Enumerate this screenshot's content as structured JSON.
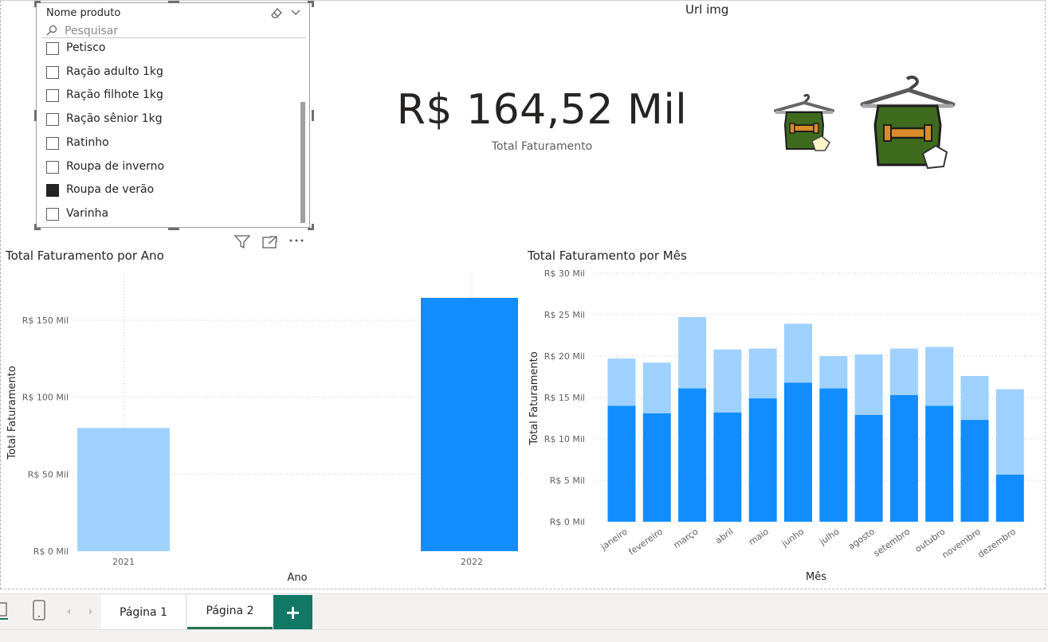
{
  "slicer": {
    "title": "Nome produto",
    "search_placeholder": "Pesquisar",
    "items": [
      {
        "label": "Petisco",
        "checked": false
      },
      {
        "label": "Ração adulto 1kg",
        "checked": false
      },
      {
        "label": "Ração filhote 1kg",
        "checked": false
      },
      {
        "label": "Ração sênior 1kg",
        "checked": false
      },
      {
        "label": "Ratinho",
        "checked": false
      },
      {
        "label": "Roupa de inverno",
        "checked": false
      },
      {
        "label": "Roupa de verão",
        "checked": true
      },
      {
        "label": "Varinha",
        "checked": false
      }
    ]
  },
  "image_visual": {
    "title": "Url img"
  },
  "card": {
    "value": "R$ 164,52 Mil",
    "label": "Total Faturamento"
  },
  "chart_data": [
    {
      "type": "bar",
      "title": "Total Faturamento por Ano",
      "xlabel": "Ano",
      "ylabel": "Total Faturamento",
      "categories": [
        "2021",
        "2022"
      ],
      "values": [
        80,
        164.52
      ],
      "ylim": [
        0,
        160
      ],
      "yticks": [
        0,
        50,
        100,
        150
      ],
      "ytick_labels": [
        "R$ 0 Mil",
        "R$ 50 Mil",
        "R$ 100 Mil",
        "R$ 150 Mil"
      ],
      "colors": [
        "#9fd1ff",
        "#118dff"
      ],
      "grid": true
    },
    {
      "type": "bar",
      "stacked": true,
      "title": "Total Faturamento por Mês",
      "xlabel": "Mês",
      "ylabel": "Total Faturamento",
      "categories": [
        "janeiro",
        "fevereiro",
        "março",
        "abril",
        "maio",
        "junho",
        "julho",
        "agosto",
        "setembro",
        "outubro",
        "novembro",
        "dezembro"
      ],
      "series": [
        {
          "values": [
            14.0,
            13.1,
            16.1,
            13.2,
            14.9,
            16.8,
            16.1,
            12.9,
            15.3,
            14.0,
            12.3,
            5.7
          ],
          "color": "#118dff"
        },
        {
          "values": [
            5.7,
            6.1,
            8.6,
            7.6,
            6.0,
            7.1,
            3.9,
            7.3,
            5.6,
            7.1,
            5.3,
            10.3
          ],
          "color": "#9fd1ff"
        }
      ],
      "ylim": [
        0,
        30
      ],
      "yticks": [
        0,
        5,
        10,
        15,
        20,
        25,
        30
      ],
      "ytick_labels": [
        "R$ 0 Mil",
        "R$ 5 Mil",
        "R$ 10 Mil",
        "R$ 15 Mil",
        "R$ 20 Mil",
        "R$ 25 Mil",
        "R$ 30 Mil"
      ],
      "grid": true
    }
  ],
  "tabs": [
    {
      "label": "Página 1",
      "active": false
    },
    {
      "label": "Página 2",
      "active": true
    }
  ],
  "tab_add_label": "+"
}
